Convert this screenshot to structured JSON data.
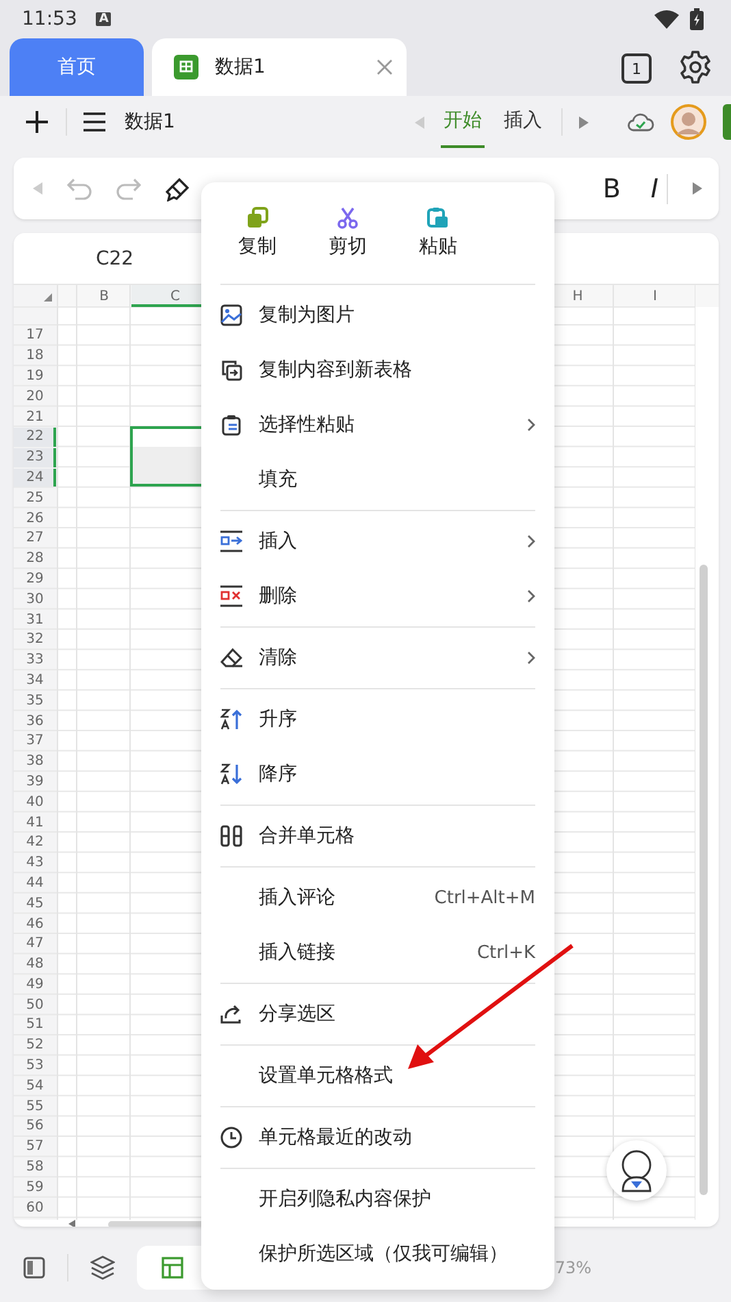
{
  "status_bar": {
    "time": "11:53",
    "notice": "A"
  },
  "tabs": [
    {
      "label": "首页",
      "kind": "home",
      "selected": false
    },
    {
      "label": "数据1",
      "kind": "document",
      "selected": true
    }
  ],
  "tab_count": "1",
  "toolbar": {
    "document_title": "数据1",
    "ribbon_tabs": [
      {
        "label": "开始",
        "selected": true
      },
      {
        "label": "插入",
        "selected": false
      }
    ]
  },
  "format_bar": {
    "text_buttons": [
      "B",
      "I"
    ]
  },
  "name_box": "C22",
  "columns": [
    {
      "label": "B",
      "selected": false
    },
    {
      "label": "C",
      "selected": true
    },
    {
      "label": "H",
      "selected": false
    },
    {
      "label": "I",
      "selected": false
    }
  ],
  "rows": [
    {
      "number": "17",
      "selected": false
    },
    {
      "number": "18",
      "selected": false
    },
    {
      "number": "19",
      "selected": false
    },
    {
      "number": "20",
      "selected": false
    },
    {
      "number": "21",
      "selected": false
    },
    {
      "number": "22",
      "selected": true
    },
    {
      "number": "23",
      "selected": true
    },
    {
      "number": "24",
      "selected": true
    },
    {
      "number": "25",
      "selected": false
    },
    {
      "number": "26",
      "selected": false
    },
    {
      "number": "27",
      "selected": false
    },
    {
      "number": "28",
      "selected": false
    },
    {
      "number": "29",
      "selected": false
    },
    {
      "number": "30",
      "selected": false
    },
    {
      "number": "31",
      "selected": false
    },
    {
      "number": "32",
      "selected": false
    },
    {
      "number": "33",
      "selected": false
    },
    {
      "number": "34",
      "selected": false
    },
    {
      "number": "35",
      "selected": false
    },
    {
      "number": "36",
      "selected": false
    },
    {
      "number": "37",
      "selected": false
    },
    {
      "number": "38",
      "selected": false
    },
    {
      "number": "39",
      "selected": false
    },
    {
      "number": "40",
      "selected": false
    },
    {
      "number": "41",
      "selected": false
    },
    {
      "number": "42",
      "selected": false
    },
    {
      "number": "43",
      "selected": false
    },
    {
      "number": "44",
      "selected": false
    },
    {
      "number": "45",
      "selected": false
    },
    {
      "number": "46",
      "selected": false
    },
    {
      "number": "47",
      "selected": false
    },
    {
      "number": "48",
      "selected": false
    },
    {
      "number": "49",
      "selected": false
    },
    {
      "number": "50",
      "selected": false
    },
    {
      "number": "51",
      "selected": false
    },
    {
      "number": "52",
      "selected": false
    },
    {
      "number": "53",
      "selected": false
    },
    {
      "number": "54",
      "selected": false
    },
    {
      "number": "55",
      "selected": false
    },
    {
      "number": "56",
      "selected": false
    },
    {
      "number": "57",
      "selected": false
    },
    {
      "number": "58",
      "selected": false
    },
    {
      "number": "59",
      "selected": false
    },
    {
      "number": "60",
      "selected": false
    }
  ],
  "bottom_bar": {
    "zoom": "73%"
  },
  "context_menu": {
    "quick_actions": [
      {
        "label": "复制",
        "kind": "copy"
      },
      {
        "label": "剪切",
        "kind": "cut"
      },
      {
        "label": "粘贴",
        "kind": "paste"
      }
    ],
    "sections": [
      [
        {
          "label": "复制为图片",
          "has_submenu": false
        },
        {
          "label": "复制内容到新表格",
          "has_submenu": false
        },
        {
          "label": "选择性粘贴",
          "has_submenu": true
        },
        {
          "label": "填充",
          "has_submenu": false
        }
      ],
      [
        {
          "label": "插入",
          "has_submenu": true
        },
        {
          "label": "删除",
          "has_submenu": true
        }
      ],
      [
        {
          "label": "清除",
          "has_submenu": true
        }
      ],
      [
        {
          "label": "升序",
          "has_submenu": false
        },
        {
          "label": "降序",
          "has_submenu": false
        }
      ],
      [
        {
          "label": "合并单元格",
          "has_submenu": false
        }
      ],
      [
        {
          "label": "插入评论",
          "shortcut": "Ctrl+Alt+M",
          "has_submenu": false
        },
        {
          "label": "插入链接",
          "shortcut": "Ctrl+K",
          "has_submenu": false
        }
      ],
      [
        {
          "label": "分享选区",
          "has_submenu": false
        }
      ],
      [
        {
          "label": "设置单元格格式",
          "has_submenu": false
        }
      ],
      [
        {
          "label": "单元格最近的改动",
          "has_submenu": false
        }
      ],
      [
        {
          "label": "开启列隐私内容保护",
          "has_submenu": false
        },
        {
          "label": "保护所选区域（仅我可编辑）",
          "has_submenu": false
        }
      ]
    ]
  }
}
